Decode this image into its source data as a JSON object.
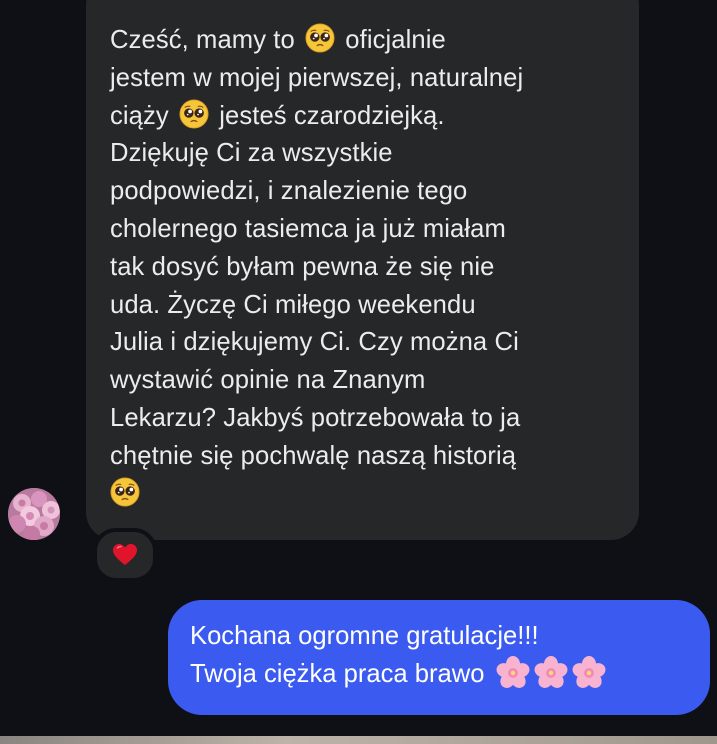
{
  "incoming_message": {
    "segments": [
      "Cześć, mamy to ",
      " oficjalnie\njestem w mojej pierwszej, naturalnej\nciąży ",
      " jesteś czarodziejką.\nDziękuję Ci za wszystkie\npodpowiedzi, i znalezienie tego\ncholernego tasiemca ja już miałam\ntak dosyć byłam pewna że się nie\nuda. Życzę Ci miłego weekendu\nJulia i dziękujemy Ci. Czy można Ci\nwystawić opinie na Znanym\nLekarzu? Jakbyś potrzebowała to ja\nchętnie się pochwalę naszą historią\n",
      ""
    ],
    "emojis": [
      "pleading-face",
      "pleading-face",
      "pleading-face"
    ],
    "reaction": "heart"
  },
  "outgoing_message": {
    "line1": "Kochana ogromne gratulacje!!!",
    "line2": "Twoja ciężka praca brawo ",
    "emojis": [
      "cherry-blossom",
      "cherry-blossom",
      "cherry-blossom"
    ]
  },
  "colors": {
    "background": "#0e1015",
    "incoming_bubble": "#262729",
    "outgoing_bubble": "#3b5bf0",
    "heart": "#e0152b"
  }
}
